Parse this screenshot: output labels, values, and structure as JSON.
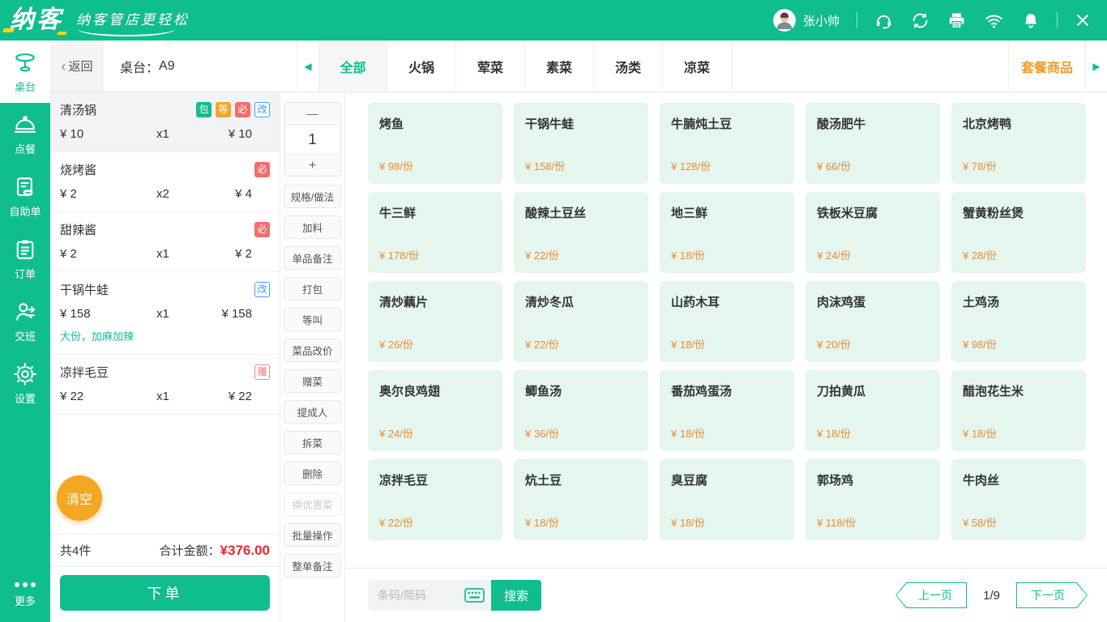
{
  "colors": {
    "brand_green": "#10bd8e",
    "accent_yellow": "#ffd21e",
    "combo_orange": "#f59a23",
    "price_orange": "#f0882f",
    "total_red": "#f5222d",
    "badge_red": "#f56c6c",
    "badge_blue": "#409eff",
    "card_bg": "#e4f6ee"
  },
  "topbar": {
    "brand": "纳客",
    "slogan": "纳客管店更轻松",
    "user": "张小帅",
    "icons": [
      "headset-icon",
      "cloud-sync-icon",
      "printer-icon",
      "wifi-icon",
      "bell-icon"
    ]
  },
  "sidebar": {
    "items": [
      {
        "id": "table",
        "label": "桌台",
        "icon": "table-icon",
        "active": true
      },
      {
        "id": "dish-order",
        "label": "点餐",
        "icon": "cloche-icon",
        "active": false
      },
      {
        "id": "self-order",
        "label": "自助单",
        "icon": "doc-icon",
        "active": false
      },
      {
        "id": "orders",
        "label": "订单",
        "icon": "clipboard-icon",
        "active": false
      },
      {
        "id": "shift",
        "label": "交班",
        "icon": "person-icon",
        "active": false
      },
      {
        "id": "settings",
        "label": "设置",
        "icon": "gear-icon",
        "active": false
      }
    ],
    "more": {
      "label": "更多",
      "icon": "dots-icon"
    }
  },
  "header": {
    "back": "返回",
    "table_label": "桌台：",
    "table_no": "A9",
    "tabs": [
      {
        "label": "全部",
        "active": true
      },
      {
        "label": "火锅",
        "active": false
      },
      {
        "label": "荤菜",
        "active": false
      },
      {
        "label": "素菜",
        "active": false
      },
      {
        "label": "汤类",
        "active": false
      },
      {
        "label": "凉菜",
        "active": false
      }
    ],
    "combo_tab": "套餐商品"
  },
  "order": {
    "items": [
      {
        "name": "清汤锅",
        "badges": [
          {
            "text": "包",
            "style": "green-solid"
          },
          {
            "text": "等",
            "style": "orange-solid"
          },
          {
            "text": "必",
            "style": "red-solid"
          },
          {
            "text": "改",
            "style": "blue-outline"
          }
        ],
        "price": "¥ 10",
        "qty": "x1",
        "total": "¥ 10",
        "note": "",
        "selected": true
      },
      {
        "name": "烧烤酱",
        "badges": [
          {
            "text": "必",
            "style": "red-solid"
          }
        ],
        "price": "¥ 2",
        "qty": "x2",
        "total": "¥ 4",
        "note": "",
        "selected": false
      },
      {
        "name": "甜辣酱",
        "badges": [
          {
            "text": "必",
            "style": "red-solid"
          }
        ],
        "price": "¥ 2",
        "qty": "x1",
        "total": "¥ 2",
        "note": "",
        "selected": false
      },
      {
        "name": "干锅牛蛙",
        "badges": [
          {
            "text": "改",
            "style": "blue-outline"
          }
        ],
        "price": "¥ 158",
        "qty": "x1",
        "total": "¥ 158",
        "note": "大份，加麻加辣",
        "selected": false
      },
      {
        "name": "凉拌毛豆",
        "badges": [
          {
            "text": "赠",
            "style": "red-outline"
          }
        ],
        "price": "¥ 22",
        "qty": "x1",
        "total": "¥ 22",
        "note": "",
        "selected": false
      }
    ],
    "clear_label": "清空",
    "summary": {
      "count": "共4件",
      "total_label": "合计金额：",
      "total_value": "¥376.00"
    },
    "submit_label": "下单"
  },
  "toolbar": {
    "minus": "—",
    "qty": "1",
    "plus": "+",
    "buttons": [
      {
        "label": "规格/做法",
        "disabled": false
      },
      {
        "label": "加料",
        "disabled": false
      },
      {
        "label": "单品备注",
        "disabled": false
      },
      {
        "label": "打包",
        "disabled": false
      },
      {
        "label": "等叫",
        "disabled": false
      },
      {
        "label": "菜品改价",
        "disabled": false
      },
      {
        "label": "赠菜",
        "disabled": false
      },
      {
        "label": "提成人",
        "disabled": false
      },
      {
        "label": "拆菜",
        "disabled": false
      },
      {
        "label": "删除",
        "disabled": false
      },
      {
        "label": "换优惠菜",
        "disabled": true
      },
      {
        "label": "批量操作",
        "disabled": false
      },
      {
        "label": "整单备注",
        "disabled": false
      }
    ]
  },
  "menu": {
    "items": [
      {
        "name": "烤鱼",
        "price": "¥ 98/份"
      },
      {
        "name": "干锅牛蛙",
        "price": "¥ 158/份"
      },
      {
        "name": "牛腩炖土豆",
        "price": "¥ 128/份"
      },
      {
        "name": "酸汤肥牛",
        "price": "¥ 66/份"
      },
      {
        "name": "北京烤鸭",
        "price": "¥ 78/份"
      },
      {
        "name": "牛三鲜",
        "price": "¥ 178/份"
      },
      {
        "name": "酸辣土豆丝",
        "price": "¥ 22/份"
      },
      {
        "name": "地三鲜",
        "price": "¥ 18/份"
      },
      {
        "name": "铁板米豆腐",
        "price": "¥ 24/份"
      },
      {
        "name": "蟹黄粉丝煲",
        "price": "¥ 28/份"
      },
      {
        "name": "清炒藕片",
        "price": "¥ 26/份"
      },
      {
        "name": "清炒冬瓜",
        "price": "¥ 22/份"
      },
      {
        "name": "山药木耳",
        "price": "¥ 18/份"
      },
      {
        "name": "肉沫鸡蛋",
        "price": "¥ 20/份"
      },
      {
        "name": "土鸡汤",
        "price": "¥ 98/份"
      },
      {
        "name": "奥尔良鸡翅",
        "price": "¥ 24/份"
      },
      {
        "name": "鲫鱼汤",
        "price": "¥ 36/份"
      },
      {
        "name": "番茄鸡蛋汤",
        "price": "¥ 18/份"
      },
      {
        "name": "刀拍黄瓜",
        "price": "¥ 18/份"
      },
      {
        "name": "醋泡花生米",
        "price": "¥ 18/份"
      },
      {
        "name": "凉拌毛豆",
        "price": "¥ 22/份"
      },
      {
        "name": "炕土豆",
        "price": "¥ 18/份"
      },
      {
        "name": "臭豆腐",
        "price": "¥ 18/份"
      },
      {
        "name": "郭场鸡",
        "price": "¥ 118/份"
      },
      {
        "name": "牛肉丝",
        "price": "¥ 58/份"
      }
    ]
  },
  "footer": {
    "search_placeholder": "条码/简码",
    "search_button": "搜索",
    "prev": "上一页",
    "page": "1/9",
    "next": "下一页"
  }
}
